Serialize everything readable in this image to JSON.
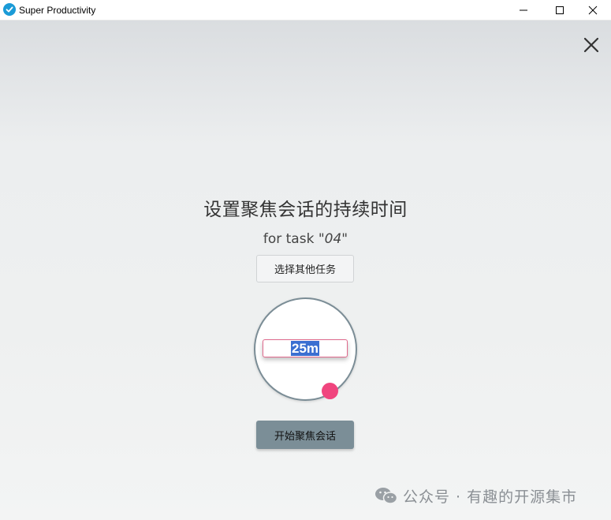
{
  "window": {
    "title": "Super Productivity",
    "icon": "check-circle-icon",
    "accent_color": "#1a9bd7"
  },
  "focus_overlay": {
    "heading": "设置聚焦会话的持续时间",
    "task_prefix": "for task \"",
    "task_name": "04",
    "task_suffix": "\"",
    "select_task_label": "选择其他任务",
    "duration_value": "25m",
    "start_label": "开始聚焦会话",
    "handle_color": "#f0457e",
    "button_color": "#7b8e97"
  },
  "watermark": {
    "text": "公众号 · 有趣的开源集市"
  }
}
